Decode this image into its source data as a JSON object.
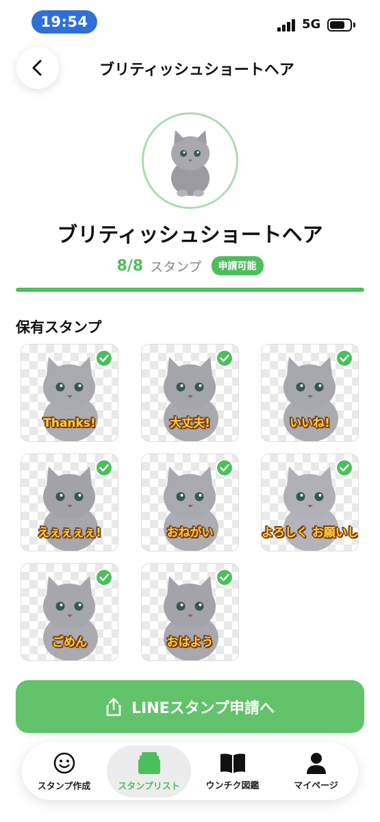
{
  "status_bar": {
    "time": "19:54",
    "network": "5G",
    "battery_level": 0.75
  },
  "header": {
    "title": "ブリティッシュショートヘア"
  },
  "profile": {
    "name": "ブリティッシュショートヘア",
    "count": "8/8",
    "count_unit": "スタンプ",
    "badge": "申請可能",
    "progress": 1.0
  },
  "section": {
    "title": "保有スタンプ"
  },
  "stamps": [
    {
      "caption": "Thanks!",
      "owned": true
    },
    {
      "caption": "大丈夫!",
      "owned": true
    },
    {
      "caption": "いいね!",
      "owned": true
    },
    {
      "caption": "えぇぇぇぇ!",
      "owned": true
    },
    {
      "caption": "おねがい",
      "owned": true
    },
    {
      "caption": "よろしく お願いします",
      "owned": true
    },
    {
      "caption": "ごめん",
      "owned": true
    },
    {
      "caption": "おはよう",
      "owned": true
    }
  ],
  "cta": {
    "label": "LINEスタンプ申請へ",
    "icon": "share-icon"
  },
  "nav": {
    "items": [
      {
        "label": "スタンプ作成",
        "icon": "smiley-icon"
      },
      {
        "label": "スタンプリスト",
        "icon": "stack-icon"
      },
      {
        "label": "ウンチク図鑑",
        "icon": "book-icon"
      },
      {
        "label": "マイページ",
        "icon": "person-icon"
      }
    ],
    "active_index": 1
  },
  "colors": {
    "accent": "#4cbf5c",
    "cta": "#62c36a",
    "time_pill": "#2f6fd6",
    "avatar_ring": "#a8ddb0"
  }
}
